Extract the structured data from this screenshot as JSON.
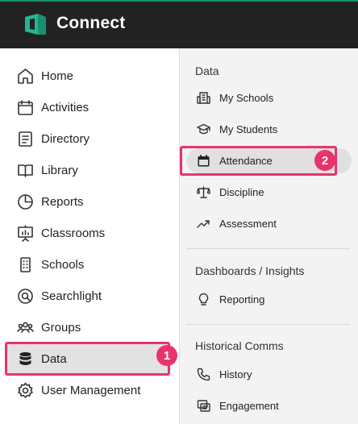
{
  "app": {
    "title": "Connect",
    "brand_color": "#1a8f6f"
  },
  "sidebar": {
    "items": [
      {
        "label": "Home",
        "icon": "home-icon"
      },
      {
        "label": "Activities",
        "icon": "calendar-icon"
      },
      {
        "label": "Directory",
        "icon": "directory-icon"
      },
      {
        "label": "Library",
        "icon": "book-icon"
      },
      {
        "label": "Reports",
        "icon": "pie-chart-icon"
      },
      {
        "label": "Classrooms",
        "icon": "presentation-icon"
      },
      {
        "label": "Schools",
        "icon": "building-icon"
      },
      {
        "label": "Searchlight",
        "icon": "searchlight-icon"
      },
      {
        "label": "Groups",
        "icon": "groups-icon"
      },
      {
        "label": "Data",
        "icon": "database-icon",
        "active": true
      },
      {
        "label": "User Management",
        "icon": "gear-icon"
      }
    ]
  },
  "panel": {
    "sections": [
      {
        "title": "Data",
        "items": [
          {
            "label": "My Schools",
            "icon": "school-icon"
          },
          {
            "label": "My Students",
            "icon": "graduation-cap-icon"
          },
          {
            "label": "Attendance",
            "icon": "calendar-filled-icon",
            "active": true
          },
          {
            "label": "Discipline",
            "icon": "scales-icon"
          },
          {
            "label": "Assessment",
            "icon": "trend-icon"
          }
        ]
      },
      {
        "title": "Dashboards / Insights",
        "items": [
          {
            "label": "Reporting",
            "icon": "lightbulb-icon"
          }
        ]
      },
      {
        "title": "Historical Comms",
        "items": [
          {
            "label": "History",
            "icon": "phone-icon"
          },
          {
            "label": "Engagement",
            "icon": "engagement-icon"
          }
        ]
      }
    ]
  },
  "annotations": [
    {
      "number": "1",
      "color": "#e8336d"
    },
    {
      "number": "2",
      "color": "#e8336d"
    }
  ]
}
